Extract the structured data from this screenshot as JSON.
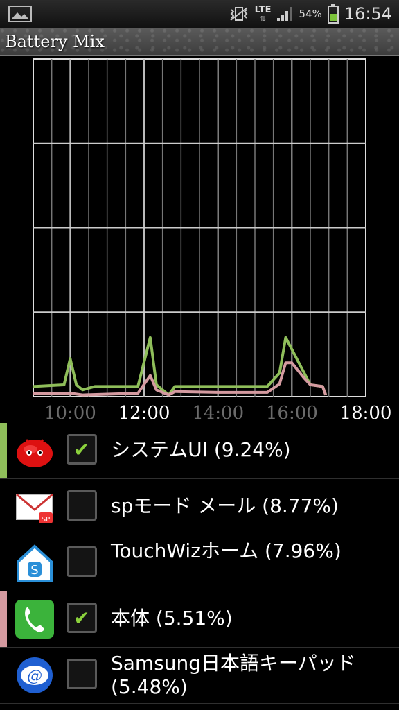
{
  "status_bar": {
    "network": "LTE",
    "battery_percent": "54%",
    "time": "16:54",
    "icons": [
      "gallery-icon",
      "mute-vibrate-icon",
      "lte-icon",
      "signal-icon",
      "battery-icon"
    ]
  },
  "app": {
    "title": "Battery Mix"
  },
  "chart_data": {
    "type": "line",
    "x_ticks": [
      "10:00",
      "12:00",
      "14:00",
      "16:00",
      "18:00"
    ],
    "x_ticks_highlighted": [
      false,
      true,
      false,
      false,
      true
    ],
    "xlim": [
      "09:00",
      "18:00"
    ],
    "ylim": [
      0,
      4
    ],
    "grid": true,
    "series": [
      {
        "color": "#8fbe5a",
        "points": [
          [
            "09:00",
            0.12
          ],
          [
            "09:50",
            0.14
          ],
          [
            "10:00",
            0.45
          ],
          [
            "10:10",
            0.14
          ],
          [
            "10:20",
            0.08
          ],
          [
            "10:40",
            0.12
          ],
          [
            "11:50",
            0.12
          ],
          [
            "12:10",
            0.7
          ],
          [
            "12:20",
            0.14
          ],
          [
            "12:40",
            0.02
          ],
          [
            "12:50",
            0.12
          ],
          [
            "15:20",
            0.12
          ],
          [
            "15:40",
            0.28
          ],
          [
            "15:50",
            0.7
          ],
          [
            "16:10",
            0.42
          ],
          [
            "16:30",
            0.14
          ],
          [
            "16:50",
            0.12
          ],
          [
            "16:55",
            0.02
          ]
        ]
      },
      {
        "color": "#d49aa0",
        "points": [
          [
            "09:00",
            0.04
          ],
          [
            "10:00",
            0.04
          ],
          [
            "10:20",
            0.02
          ],
          [
            "11:50",
            0.04
          ],
          [
            "12:10",
            0.25
          ],
          [
            "12:20",
            0.08
          ],
          [
            "12:40",
            0.02
          ],
          [
            "12:50",
            0.06
          ],
          [
            "14:00",
            0.05
          ],
          [
            "15:20",
            0.05
          ],
          [
            "15:40",
            0.15
          ],
          [
            "15:50",
            0.4
          ],
          [
            "16:00",
            0.4
          ],
          [
            "16:20",
            0.22
          ],
          [
            "16:30",
            0.14
          ],
          [
            "16:50",
            0.12
          ],
          [
            "16:55",
            0.02
          ]
        ]
      }
    ]
  },
  "list": {
    "items": [
      {
        "label": "システムUI (9.24%)",
        "checked": true,
        "marker_color": "#8fbe5a",
        "icon": "android-jellybean-icon"
      },
      {
        "label": "spモード メール (8.77%)",
        "checked": false,
        "marker_color": "",
        "icon": "sp-mail-icon"
      },
      {
        "label": "TouchWizホーム (7.96%)",
        "checked": false,
        "marker_color": "",
        "icon": "touchwiz-home-icon"
      },
      {
        "label": "本体 (5.51%)",
        "checked": true,
        "marker_color": "#d49aa0",
        "icon": "phone-icon"
      },
      {
        "label": "Samsung日本語キーパッド (5.48%)",
        "checked": false,
        "marker_color": "",
        "icon": "samsung-keypad-icon"
      }
    ]
  }
}
